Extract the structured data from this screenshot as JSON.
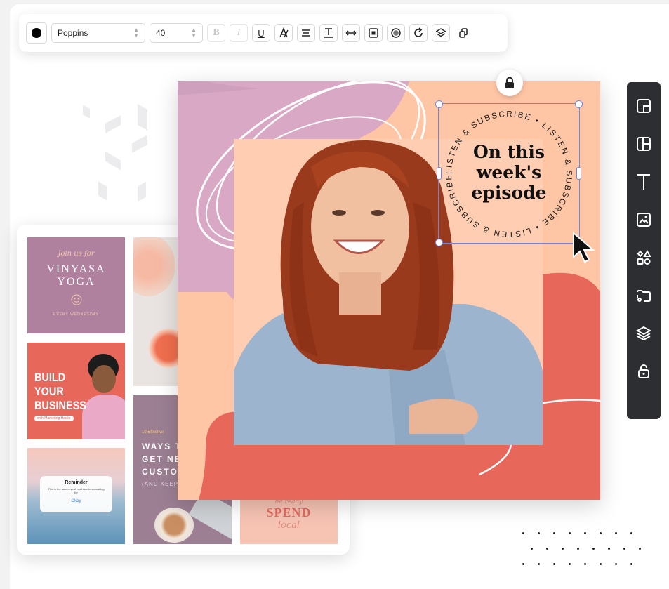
{
  "toolbar": {
    "color": "#000000",
    "font_family": "Poppins",
    "font_size": "40",
    "buttons": [
      "bold-icon",
      "italic-icon",
      "underline-icon",
      "text-style-icon",
      "align-center-icon",
      "line-height-icon",
      "letter-spacing-icon",
      "text-box-icon",
      "opacity-icon",
      "rotate-icon",
      "layers-icon",
      "duplicate-icon"
    ]
  },
  "design": {
    "headline_lines": [
      "On this",
      "week's",
      "episode"
    ],
    "circle_text": "LISTEN & SUBSCRIBE • LISTEN & SUBSCRIBE • LISTEN & SUBSCRIBE •",
    "colors": {
      "background": "#ffc6a6",
      "blob_purple": "#d9a8c4",
      "blob_coral": "#e8675b",
      "selection": "#6f86e0"
    }
  },
  "gallery": {
    "yoga": {
      "script": "Join us for",
      "line1": "VINYASA",
      "line2": "YOGA",
      "footer": "EVERY WEDNESDAY"
    },
    "business": {
      "line1": "BUILD",
      "line2": "YOUR",
      "line3": "BUSINESS",
      "tag": "with Marketing Hacks"
    },
    "ways": {
      "small": "10 Effective",
      "line1": "WAYS T",
      "line2": "GET NE",
      "line3": "CUSTO",
      "line4": "(AND KEEP"
    },
    "reminder": {
      "title": "Reminder",
      "body": "This is the auto-reveal you have been waiting for",
      "button": "Okay"
    },
    "spend": {
      "line1": "SPEND",
      "script_top": "be ready",
      "script_bottom": "local"
    }
  },
  "sidebar": {
    "tools": [
      "template-icon",
      "layout-icon",
      "text-icon",
      "image-icon",
      "elements-icon",
      "upload-icon",
      "layers-icon",
      "lock-icon"
    ]
  }
}
